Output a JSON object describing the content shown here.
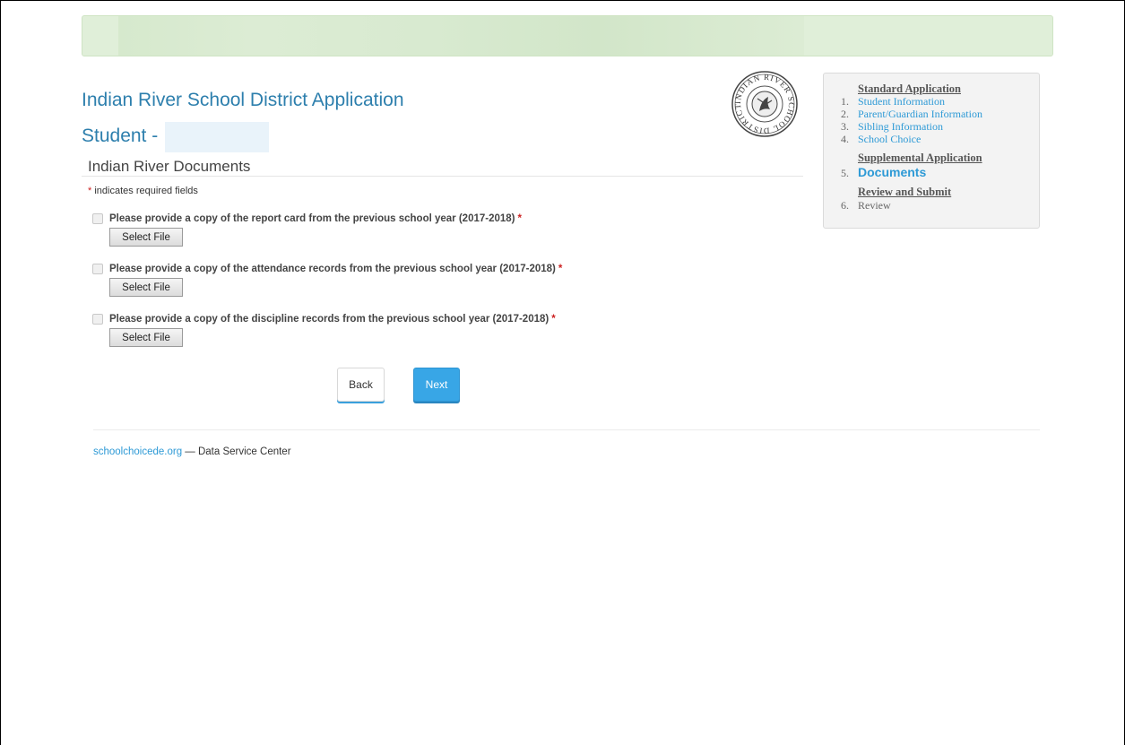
{
  "header": {
    "app_title": "Indian River School District Application",
    "student_label": "Student -",
    "seal_text": "INDIAN RIVER SCHOOL DISTRICT"
  },
  "form": {
    "section_title": "Indian River Documents",
    "required_marker": "*",
    "required_note": "indicates required fields",
    "documents": [
      {
        "label": "Please provide a copy of the report card from the previous school year (2017-2018)",
        "button": "Select File",
        "checked": false
      },
      {
        "label": "Please provide a copy of the attendance records from the previous school year (2017-2018)",
        "button": "Select File",
        "checked": false
      },
      {
        "label": "Please provide a copy of the discipline records from the previous school year (2017-2018)",
        "button": "Select File",
        "checked": false
      }
    ],
    "back_label": "Back",
    "next_label": "Next"
  },
  "footer": {
    "link_text": "schoolchoicede.org",
    "text": " — Data Service Center"
  },
  "sidebar": {
    "standard_heading": "Standard Application",
    "supplemental_heading": "Supplemental Application",
    "review_heading": "Review and Submit",
    "steps": [
      {
        "num": "1.",
        "label": "Student Information"
      },
      {
        "num": "2.",
        "label": "Parent/Guardian Information"
      },
      {
        "num": "3.",
        "label": "Sibling Information"
      },
      {
        "num": "4.",
        "label": "School Choice"
      },
      {
        "num": "5.",
        "label": "Documents"
      },
      {
        "num": "6.",
        "label": "Review"
      }
    ]
  },
  "colors": {
    "title_blue": "#2d7fad",
    "link_blue": "#2e9ad6",
    "next_button": "#38a6e6",
    "banner_green": "#e0efd9",
    "required_red": "#cc2222"
  }
}
